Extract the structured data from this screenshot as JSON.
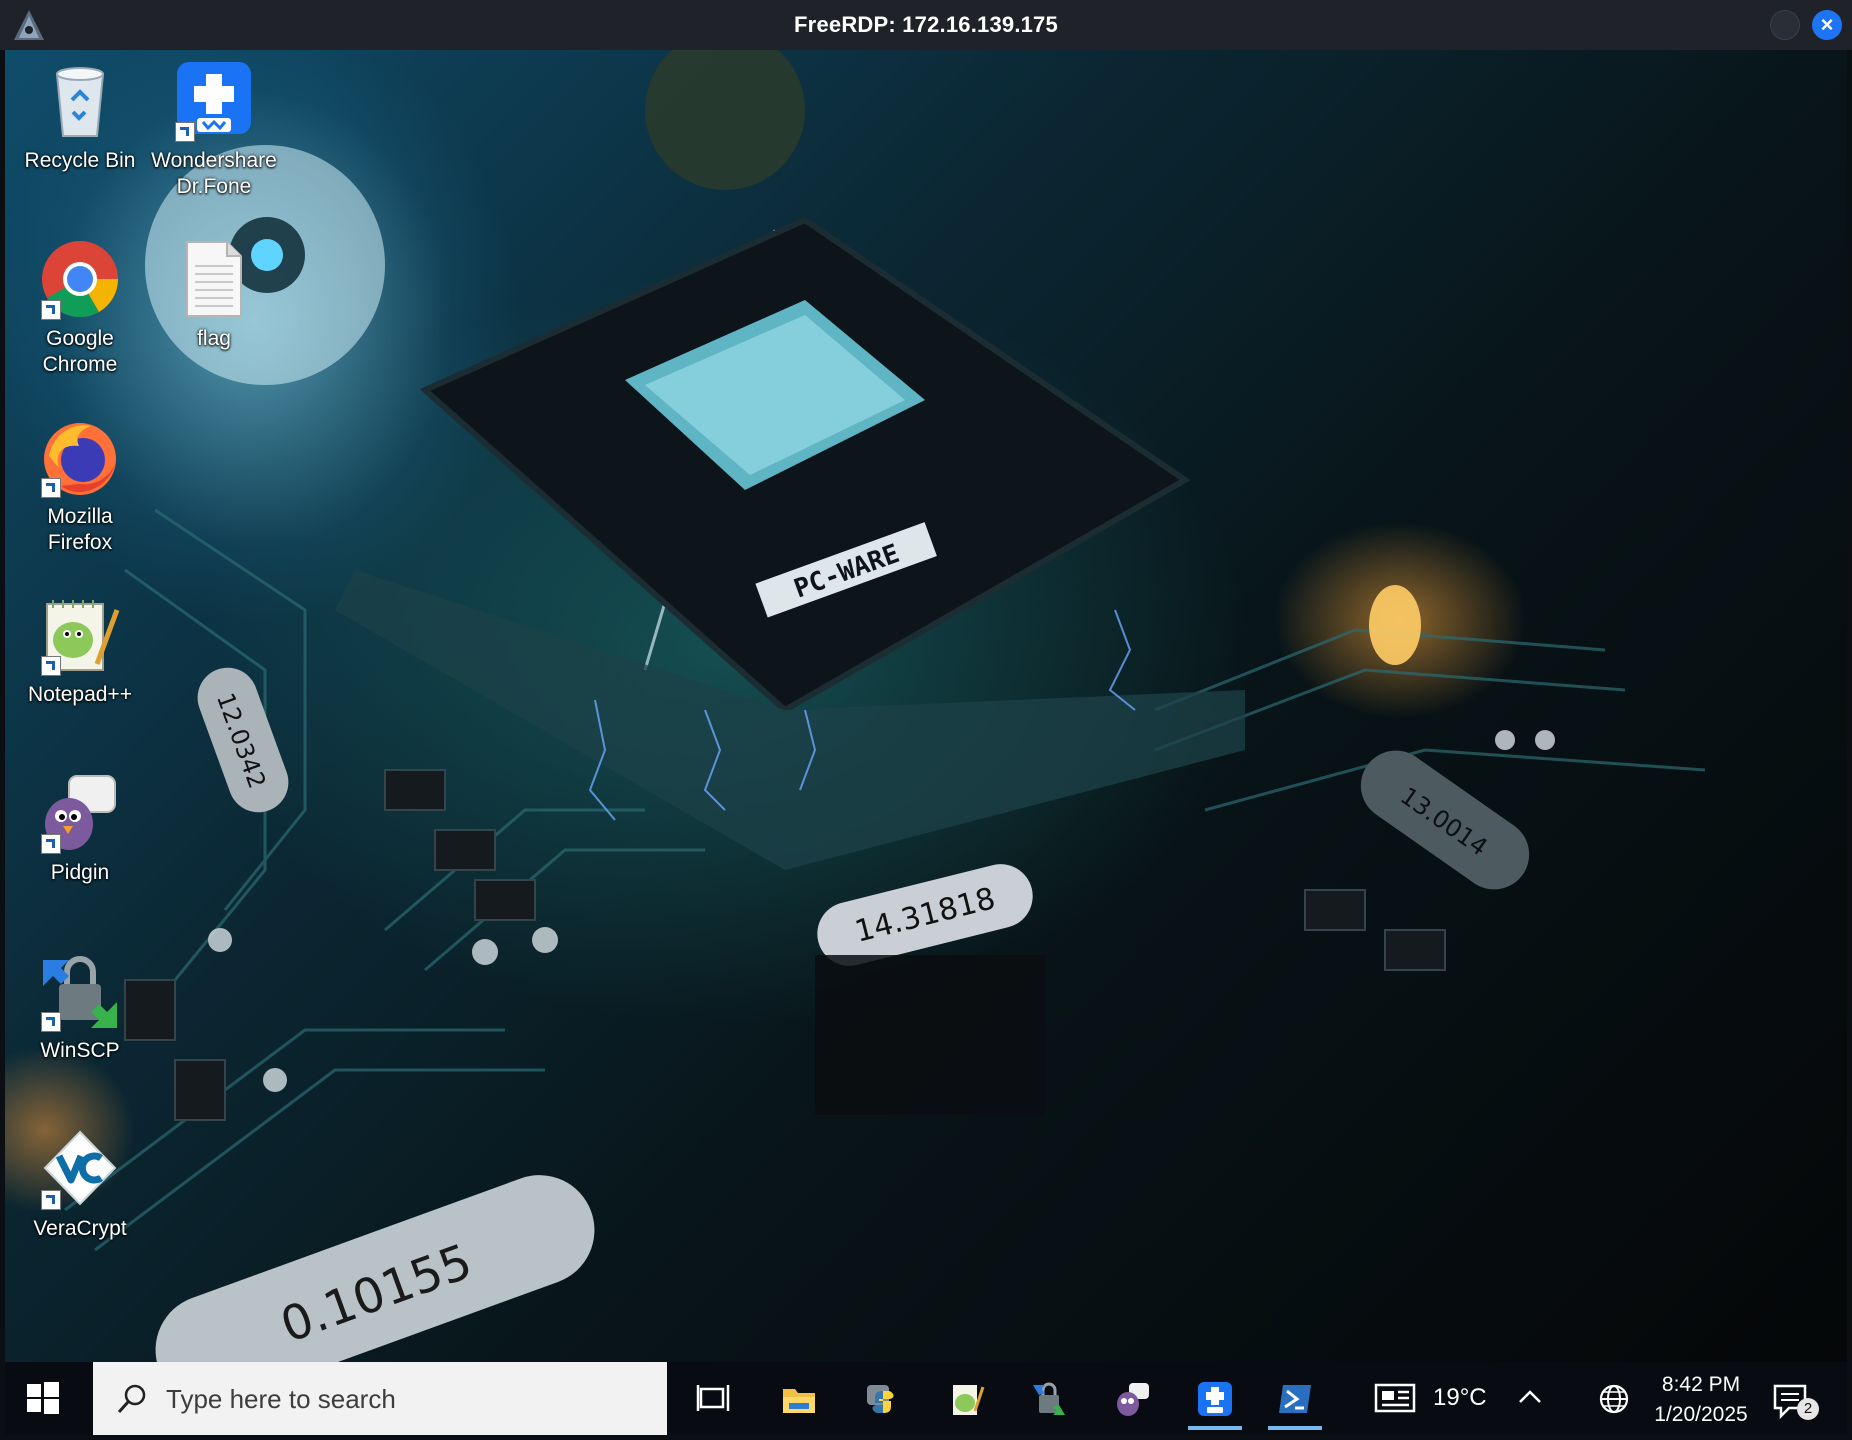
{
  "window": {
    "title": "FreeRDP: 172.16.139.175",
    "close_label": "×"
  },
  "wallpaper_labels": {
    "chip": "PC-WARE",
    "crystal_1": "14.31818",
    "crystal_2": "12.0342",
    "crystal_3": "13.0014",
    "crystal_4": "0.10155"
  },
  "desktop_icons": [
    {
      "label": "Recycle Bin",
      "icon": "recycle-bin-icon"
    },
    {
      "label": "Wondershare Dr.Fone",
      "icon": "drfone-icon"
    },
    {
      "label": "Google Chrome",
      "icon": "chrome-icon"
    },
    {
      "label": "flag",
      "icon": "text-file-icon"
    },
    {
      "label": "Mozilla Firefox",
      "icon": "firefox-icon"
    },
    {
      "label": "Notepad++",
      "icon": "notepadpp-icon"
    },
    {
      "label": "Pidgin",
      "icon": "pidgin-icon"
    },
    {
      "label": "WinSCP",
      "icon": "winscp-icon"
    },
    {
      "label": "VeraCrypt",
      "icon": "veracrypt-icon"
    }
  ],
  "taskbar": {
    "search_placeholder": "Type here to search",
    "apps": [
      {
        "icon": "task-view-icon"
      },
      {
        "icon": "file-explorer-icon"
      },
      {
        "icon": "python-icon"
      },
      {
        "icon": "notepadpp-icon"
      },
      {
        "icon": "winscp-icon"
      },
      {
        "icon": "pidgin-icon"
      },
      {
        "icon": "drfone-icon"
      },
      {
        "icon": "powershell-icon"
      }
    ],
    "temperature": "19°C",
    "time": "8:42 PM",
    "date": "1/20/2025",
    "notification_count": "2"
  },
  "colors": {
    "accent": "#1d74f5",
    "taskbar_indicator": "#76b9ed"
  }
}
